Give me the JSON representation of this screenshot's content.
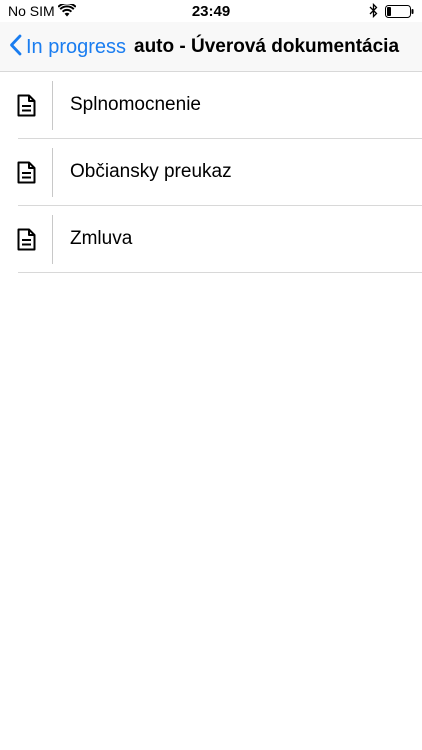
{
  "status_bar": {
    "carrier": "No SIM",
    "time": "23:49"
  },
  "nav": {
    "back_label": "In progress",
    "title": "auto - Úverová dokumentácia"
  },
  "documents": [
    {
      "label": "Splnomocnenie",
      "icon": "document-icon"
    },
    {
      "label": "Občiansky preukaz",
      "icon": "document-icon"
    },
    {
      "label": "Zmluva",
      "icon": "document-icon"
    }
  ],
  "colors": {
    "accent": "#1a7df0",
    "divider": "#d8d8d8",
    "nav_background": "#f8f8f8"
  }
}
